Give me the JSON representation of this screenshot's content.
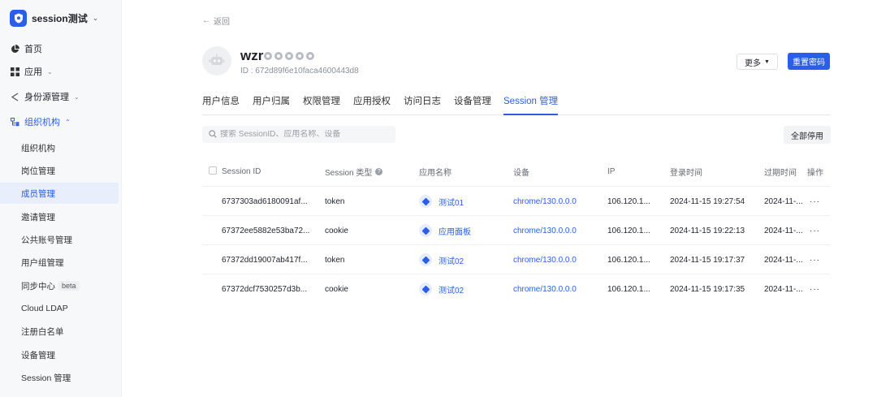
{
  "brand": {
    "name": "session测试"
  },
  "sidebar": {
    "items": [
      {
        "label": "首页"
      },
      {
        "label": "应用"
      },
      {
        "label": "身份源管理"
      },
      {
        "label": "组织机构"
      }
    ],
    "subitems": [
      {
        "label": "组织机构"
      },
      {
        "label": "岗位管理"
      },
      {
        "label": "成员管理"
      },
      {
        "label": "邀请管理"
      },
      {
        "label": "公共账号管理"
      },
      {
        "label": "用户组管理"
      },
      {
        "label": "同步中心",
        "badge": "beta"
      },
      {
        "label": "Cloud LDAP"
      },
      {
        "label": "注册白名单"
      },
      {
        "label": "设备管理"
      },
      {
        "label": "Session 管理"
      }
    ]
  },
  "header": {
    "back_label": "返回",
    "user_name": "wzr",
    "user_id": "ID : 672d89f6e10faca4600443d8",
    "more_label": "更多",
    "reset_password_label": "重置密码"
  },
  "tabs": [
    {
      "label": "用户信息"
    },
    {
      "label": "用户归属"
    },
    {
      "label": "权限管理"
    },
    {
      "label": "应用授权"
    },
    {
      "label": "访问日志"
    },
    {
      "label": "设备管理"
    },
    {
      "label": "Session 管理"
    }
  ],
  "search": {
    "placeholder": "搜索 SessionID、应用名称、设备"
  },
  "disable_all_label": "全部停用",
  "table": {
    "columns": [
      "Session ID",
      "Session 类型",
      "应用名称",
      "设备",
      "IP",
      "登录时间",
      "过期时间",
      "操作"
    ],
    "rows": [
      {
        "session_id": "6737303ad6180091af...",
        "type": "token",
        "app": "测试01",
        "device": "chrome/130.0.0.0",
        "ip": "106.120.1...",
        "login_time": "2024-11-15 19:27:54",
        "expire_time": "2024-11-...",
        "ops": "···"
      },
      {
        "session_id": "67372ee5882e53ba72...",
        "type": "cookie",
        "app": "应用面板",
        "device": "chrome/130.0.0.0",
        "ip": "106.120.1...",
        "login_time": "2024-11-15 19:22:13",
        "expire_time": "2024-11-...",
        "ops": "···"
      },
      {
        "session_id": "67372dd19007ab417f...",
        "type": "token",
        "app": "测试02",
        "device": "chrome/130.0.0.0",
        "ip": "106.120.1...",
        "login_time": "2024-11-15 19:17:37",
        "expire_time": "2024-11-...",
        "ops": "···"
      },
      {
        "session_id": "67372dcf7530257d3b...",
        "type": "cookie",
        "app": "测试02",
        "device": "chrome/130.0.0.0",
        "ip": "106.120.1...",
        "login_time": "2024-11-15 19:17:35",
        "expire_time": "2024-11-...",
        "ops": "···"
      }
    ]
  },
  "colors": {
    "accent": "#2a5ee8",
    "sidebar_bg": "#f7f8fa",
    "active_bg": "#e8eefc"
  },
  "icons": [
    "shield-logo-icon",
    "pie-chart-icon",
    "apps-grid-icon",
    "share-icon",
    "org-tree-icon",
    "search-icon",
    "robot-avatar-icon",
    "app-cube-icon"
  ]
}
